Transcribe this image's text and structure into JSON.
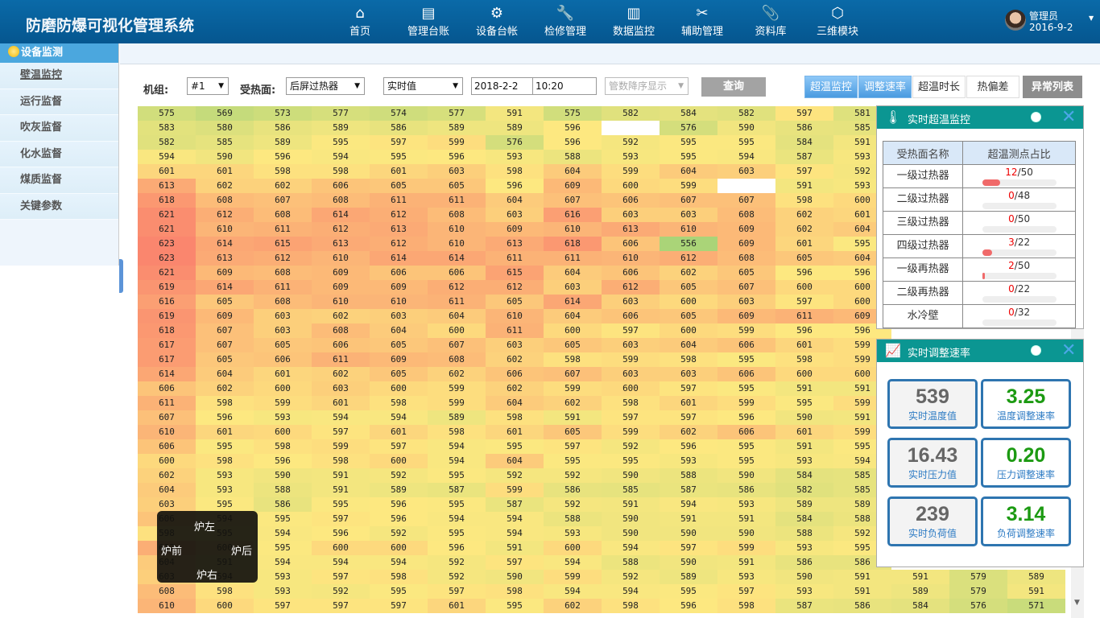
{
  "app": {
    "title": "防磨防爆可视化管理系统"
  },
  "nav": [
    {
      "label": "首页",
      "icon": "home-icon",
      "glyph": "⌂"
    },
    {
      "label": "管理台账",
      "icon": "ledger-icon",
      "glyph": "▤"
    },
    {
      "label": "设备台帐",
      "icon": "gear-icon",
      "glyph": "⚙"
    },
    {
      "label": "检修管理",
      "icon": "wrench-icon",
      "glyph": "🔧"
    },
    {
      "label": "数据监控",
      "icon": "monitor-chart-icon",
      "glyph": "▥"
    },
    {
      "label": "辅助管理",
      "icon": "tools-icon",
      "glyph": "✂"
    },
    {
      "label": "资料库",
      "icon": "paperclip-icon",
      "glyph": "📎"
    },
    {
      "label": "三维模块",
      "icon": "cube-icon",
      "glyph": "⬡"
    }
  ],
  "user": {
    "name": "管理员",
    "date": "2016-9-2"
  },
  "sidebar": {
    "header": "设备监测",
    "items": [
      {
        "label": "壁温监控"
      },
      {
        "label": "运行监督"
      },
      {
        "label": "吹灰监督"
      },
      {
        "label": "化水监督"
      },
      {
        "label": "煤质监督"
      },
      {
        "label": "关键参数"
      }
    ]
  },
  "toolbar": {
    "unit_label": "机组:",
    "unit_value": "#1",
    "surface_label": "受热面:",
    "surface_value": "后屏过热器",
    "mode_value": "实时值",
    "date_value": "2018-2-2",
    "time_value": "10:20",
    "sort_placeholder": "管数降序显示",
    "query_label": "查询",
    "tabs": [
      {
        "label": "超温监控",
        "state": "on"
      },
      {
        "label": "调整速率",
        "state": "on"
      },
      {
        "label": "超温时长",
        "state": "off"
      },
      {
        "label": "热偏差",
        "state": "off"
      },
      {
        "label": "异常列表",
        "state": "dark"
      }
    ]
  },
  "grid": {
    "columns": 16,
    "rows": [
      [
        575,
        569,
        573,
        577,
        574,
        577,
        591,
        575,
        582,
        584,
        582,
        597,
        581,
        null,
        null,
        null
      ],
      [
        583,
        580,
        586,
        589,
        586,
        589,
        589,
        596,
        "",
        576,
        590,
        586,
        585,
        null,
        null,
        null
      ],
      [
        582,
        585,
        589,
        595,
        597,
        599,
        576,
        596,
        592,
        595,
        595,
        584,
        591,
        null,
        null,
        null
      ],
      [
        594,
        590,
        596,
        594,
        595,
        596,
        593,
        588,
        593,
        595,
        594,
        587,
        593,
        null,
        null,
        null
      ],
      [
        601,
        601,
        598,
        598,
        601,
        603,
        598,
        604,
        599,
        604,
        603,
        597,
        592,
        null,
        null,
        null
      ],
      [
        613,
        602,
        602,
        606,
        605,
        605,
        596,
        609,
        600,
        599,
        "",
        591,
        593,
        null,
        null,
        null
      ],
      [
        618,
        608,
        607,
        608,
        611,
        611,
        604,
        607,
        606,
        607,
        607,
        598,
        600,
        null,
        null,
        null
      ],
      [
        621,
        612,
        608,
        614,
        612,
        608,
        603,
        616,
        603,
        603,
        608,
        602,
        601,
        null,
        null,
        null
      ],
      [
        621,
        610,
        611,
        612,
        613,
        610,
        609,
        610,
        613,
        610,
        609,
        602,
        604,
        null,
        null,
        null
      ],
      [
        623,
        614,
        615,
        613,
        612,
        610,
        613,
        618,
        606,
        556,
        609,
        601,
        595,
        null,
        null,
        null
      ],
      [
        623,
        613,
        612,
        610,
        614,
        614,
        611,
        611,
        610,
        612,
        608,
        605,
        604,
        null,
        null,
        null
      ],
      [
        621,
        609,
        608,
        609,
        606,
        606,
        615,
        604,
        606,
        602,
        605,
        596,
        596,
        null,
        null,
        null
      ],
      [
        619,
        614,
        611,
        609,
        609,
        612,
        612,
        603,
        612,
        605,
        607,
        600,
        600,
        null,
        null,
        null
      ],
      [
        616,
        605,
        608,
        610,
        610,
        611,
        605,
        614,
        603,
        600,
        603,
        597,
        600,
        null,
        null,
        null
      ],
      [
        619,
        609,
        603,
        602,
        603,
        604,
        610,
        604,
        606,
        605,
        609,
        611,
        609,
        null,
        null,
        null
      ],
      [
        618,
        607,
        603,
        608,
        604,
        600,
        611,
        600,
        597,
        600,
        599,
        596,
        596,
        null,
        null,
        null
      ],
      [
        617,
        607,
        605,
        606,
        605,
        607,
        603,
        605,
        603,
        604,
        606,
        601,
        599,
        null,
        null,
        null
      ],
      [
        617,
        605,
        606,
        611,
        609,
        608,
        602,
        598,
        599,
        598,
        595,
        598,
        599,
        null,
        null,
        null
      ],
      [
        614,
        604,
        601,
        602,
        605,
        602,
        606,
        607,
        603,
        603,
        606,
        600,
        600,
        null,
        null,
        null
      ],
      [
        606,
        602,
        600,
        603,
        600,
        599,
        602,
        599,
        600,
        597,
        595,
        591,
        591,
        null,
        null,
        null
      ],
      [
        611,
        598,
        599,
        601,
        598,
        599,
        604,
        602,
        598,
        601,
        599,
        595,
        599,
        null,
        null,
        null
      ],
      [
        607,
        596,
        593,
        594,
        594,
        589,
        598,
        591,
        597,
        597,
        596,
        590,
        591,
        null,
        null,
        null
      ],
      [
        610,
        601,
        600,
        597,
        601,
        598,
        601,
        605,
        599,
        602,
        606,
        601,
        599,
        null,
        null,
        null
      ],
      [
        606,
        595,
        598,
        599,
        597,
        594,
        595,
        597,
        592,
        596,
        595,
        591,
        595,
        null,
        null,
        null
      ],
      [
        600,
        598,
        596,
        598,
        600,
        594,
        604,
        595,
        595,
        593,
        595,
        593,
        594,
        null,
        null,
        null
      ],
      [
        602,
        593,
        590,
        591,
        592,
        595,
        592,
        592,
        590,
        588,
        590,
        584,
        585,
        null,
        null,
        null
      ],
      [
        604,
        593,
        588,
        591,
        589,
        587,
        599,
        586,
        585,
        587,
        586,
        582,
        585,
        null,
        null,
        null
      ],
      [
        603,
        595,
        586,
        595,
        596,
        595,
        587,
        592,
        591,
        594,
        593,
        589,
        589,
        null,
        null,
        null
      ],
      [
        606,
        594,
        595,
        597,
        596,
        594,
        594,
        588,
        590,
        591,
        591,
        584,
        588,
        null,
        null,
        null
      ],
      [
        598,
        595,
        594,
        596,
        592,
        595,
        594,
        593,
        590,
        590,
        590,
        588,
        592,
        null,
        null,
        null
      ],
      [
        612,
        600,
        595,
        600,
        600,
        596,
        591,
        600,
        594,
        597,
        599,
        593,
        595,
        null,
        null,
        null
      ],
      [
        604,
        591,
        594,
        594,
        594,
        592,
        597,
        594,
        588,
        590,
        591,
        586,
        586,
        null,
        null,
        null
      ],
      [
        603,
        594,
        593,
        597,
        598,
        592,
        590,
        599,
        592,
        589,
        593,
        590,
        591,
        591,
        579,
        589
      ],
      [
        608,
        598,
        593,
        592,
        595,
        597,
        598,
        594,
        594,
        595,
        597,
        593,
        591,
        589,
        579,
        591
      ],
      [
        610,
        600,
        597,
        597,
        597,
        601,
        595,
        602,
        598,
        596,
        598,
        587,
        586,
        584,
        576,
        571
      ]
    ]
  },
  "compass": {
    "top": "炉左",
    "left": "炉前",
    "right": "炉后",
    "bottom": "炉右"
  },
  "overtemp_panel": {
    "title": "实时超温监控",
    "col_name": "受热面名称",
    "col_ratio": "超温测点占比",
    "rows": [
      {
        "name": "一级过热器",
        "over": 12,
        "total": 50
      },
      {
        "name": "二级过热器",
        "over": 0,
        "total": 48
      },
      {
        "name": "三级过热器",
        "over": 0,
        "total": 50
      },
      {
        "name": "四级过热器",
        "over": 3,
        "total": 22
      },
      {
        "name": "一级再热器",
        "over": 2,
        "total": 50
      },
      {
        "name": "二级再热器",
        "over": 0,
        "total": 22
      },
      {
        "name": "水冷壁",
        "over": 0,
        "total": 32
      }
    ]
  },
  "rate_panel": {
    "title": "实时调整速率",
    "boxes": [
      {
        "value": "539",
        "caption": "实时温度值",
        "style": "grey"
      },
      {
        "value": "3.25",
        "caption": "温度调整速率",
        "style": "green"
      },
      {
        "value": "16.43",
        "caption": "实时压力值",
        "style": "grey"
      },
      {
        "value": "0.20",
        "caption": "压力调整速率",
        "style": "green"
      },
      {
        "value": "239",
        "caption": "实时负荷值",
        "style": "grey"
      },
      {
        "value": "3.14",
        "caption": "负荷调整速率",
        "style": "green"
      }
    ]
  },
  "colors": {
    "header": "#0a6aa8",
    "panel_head": "#0b9692",
    "accent_blue": "#4a9be0",
    "alarm_red": "#f06a6a",
    "good_green": "#1c9a12"
  }
}
